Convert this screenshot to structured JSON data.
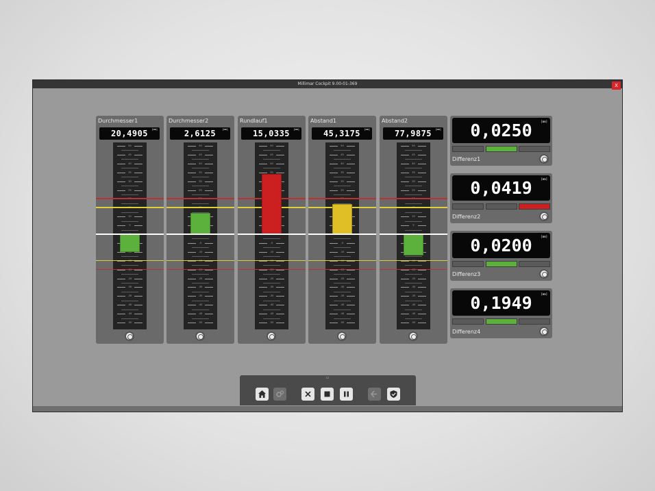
{
  "window": {
    "title": "Millimar Cockpit 9.00-01-369",
    "close_label": "X"
  },
  "scale": {
    "labels": [
      "50",
      "45",
      "40",
      "35",
      "30",
      "25",
      "20",
      "15",
      "10",
      "5",
      "0",
      "-5",
      "-10",
      "-15",
      "-20",
      "-25",
      "-30",
      "-35",
      "-40",
      "-45",
      "-50"
    ]
  },
  "unit": "[mm]",
  "gauges": [
    {
      "name": "Durchmesser1",
      "value": "20,4905",
      "bar_from": -10,
      "bar_to": 0,
      "bar_color": "#5cb03c"
    },
    {
      "name": "Durchmesser2",
      "value": "2,6125",
      "bar_from": 0,
      "bar_to": 12,
      "bar_color": "#5cb03c"
    },
    {
      "name": "Rundlauf1",
      "value": "15,0335",
      "bar_from": 0,
      "bar_to": 34,
      "bar_color": "#cc1f1f"
    },
    {
      "name": "Abstand1",
      "value": "45,3175",
      "bar_from": 0,
      "bar_to": 17,
      "bar_color": "#e0be26"
    },
    {
      "name": "Abstand2",
      "value": "77,9875",
      "bar_from": -12,
      "bar_to": 0,
      "bar_color": "#5cb03c"
    }
  ],
  "differences": [
    {
      "name": "Differenz1",
      "value": "0,0250",
      "active_segment": 2,
      "status_color": "#5cb03c"
    },
    {
      "name": "Differenz2",
      "value": "0,0419",
      "active_segment": 3,
      "status_color": "#cc1f1f"
    },
    {
      "name": "Differenz3",
      "value": "0,0200",
      "active_segment": 2,
      "status_color": "#5cb03c"
    },
    {
      "name": "Differenz4",
      "value": "0,1949",
      "active_segment": 2,
      "status_color": "#5cb03c"
    }
  ],
  "toolbar": {
    "buttons": [
      {
        "icon": "home-icon",
        "enabled": true
      },
      {
        "icon": "gears-icon",
        "enabled": false
      },
      {
        "icon": "clear-icon",
        "enabled": true
      },
      {
        "icon": "stop-icon",
        "enabled": true
      },
      {
        "icon": "pause-icon",
        "enabled": true
      },
      {
        "icon": "logout-icon",
        "enabled": false
      },
      {
        "icon": "shield-check-icon",
        "enabled": true
      }
    ]
  },
  "colors": {
    "green": "#5cb03c",
    "red": "#cc1f1f",
    "yellow": "#e0be26"
  }
}
